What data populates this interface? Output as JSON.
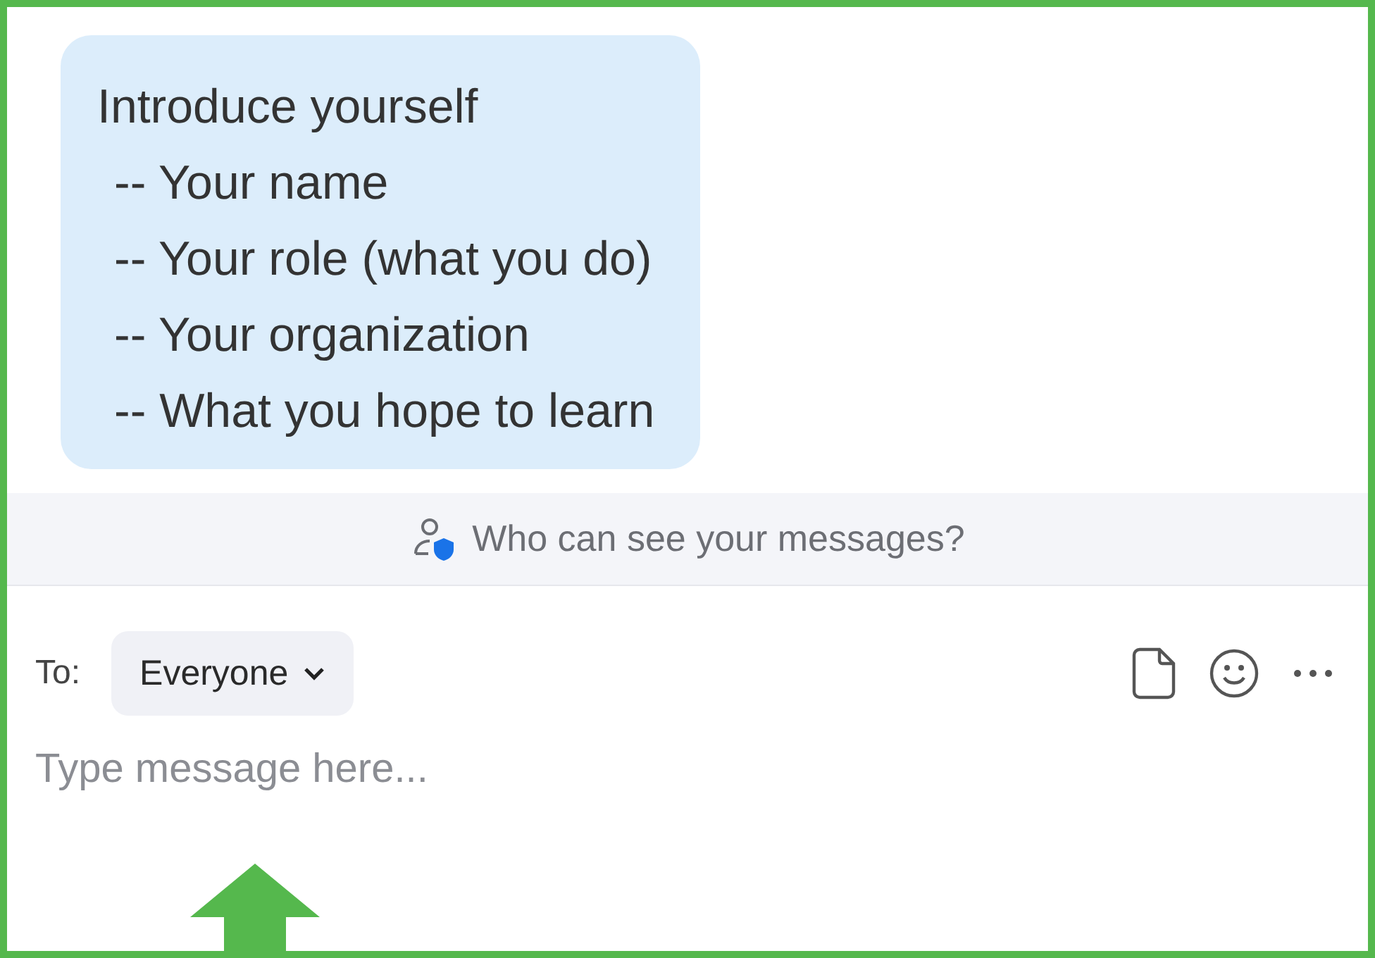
{
  "message": {
    "lines": [
      "Introduce yourself",
      "-- Your name",
      "-- Your role (what you do)",
      "-- Your organization",
      "-- What you hope to learn"
    ]
  },
  "privacy_notice": {
    "text": "Who can see your messages?"
  },
  "composer": {
    "to_label": "To:",
    "recipient": "Everyone",
    "placeholder": "Type message here..."
  }
}
